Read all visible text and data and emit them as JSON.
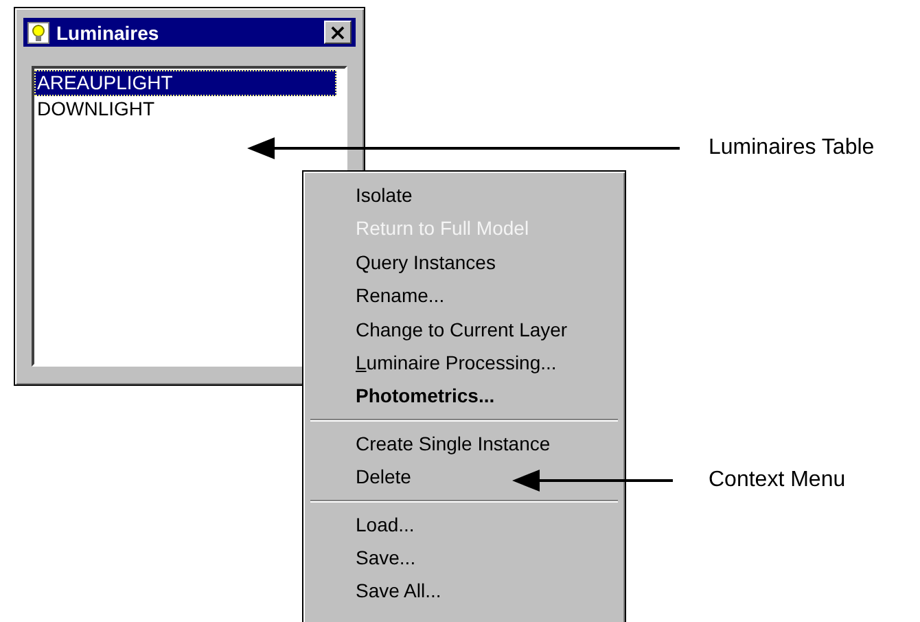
{
  "window": {
    "title": "Luminaires",
    "close_label": "×"
  },
  "list": [
    {
      "label": "AREAUPLIGHT",
      "selected": true
    },
    {
      "label": "DOWNLIGHT",
      "selected": false
    }
  ],
  "context_menu": [
    {
      "kind": "item",
      "label": "Isolate",
      "disabled": false,
      "default": false,
      "mnemonic": false
    },
    {
      "kind": "item",
      "label": "Return to Full Model",
      "disabled": true,
      "default": false,
      "mnemonic": false
    },
    {
      "kind": "item",
      "label": "Query Instances",
      "disabled": false,
      "default": false,
      "mnemonic": false
    },
    {
      "kind": "item",
      "label": "Rename...",
      "disabled": false,
      "default": false,
      "mnemonic": false
    },
    {
      "kind": "item",
      "label": "Change to Current Layer",
      "disabled": false,
      "default": false,
      "mnemonic": false
    },
    {
      "kind": "item",
      "label": "Luminaire Processing...",
      "disabled": false,
      "default": false,
      "mnemonic": true
    },
    {
      "kind": "item",
      "label": "Photometrics...",
      "disabled": false,
      "default": true,
      "mnemonic": false
    },
    {
      "kind": "separator"
    },
    {
      "kind": "item",
      "label": "Create Single Instance",
      "disabled": false,
      "default": false,
      "mnemonic": false
    },
    {
      "kind": "item",
      "label": "Delete",
      "disabled": false,
      "default": false,
      "mnemonic": false
    },
    {
      "kind": "separator"
    },
    {
      "kind": "item",
      "label": "Load...",
      "disabled": false,
      "default": false,
      "mnemonic": false
    },
    {
      "kind": "item",
      "label": "Save...",
      "disabled": false,
      "default": false,
      "mnemonic": false
    },
    {
      "kind": "item",
      "label": "Save All...",
      "disabled": false,
      "default": false,
      "mnemonic": false
    }
  ],
  "callouts": [
    {
      "label": "Luminaires Table"
    },
    {
      "label": "Context Menu"
    }
  ]
}
